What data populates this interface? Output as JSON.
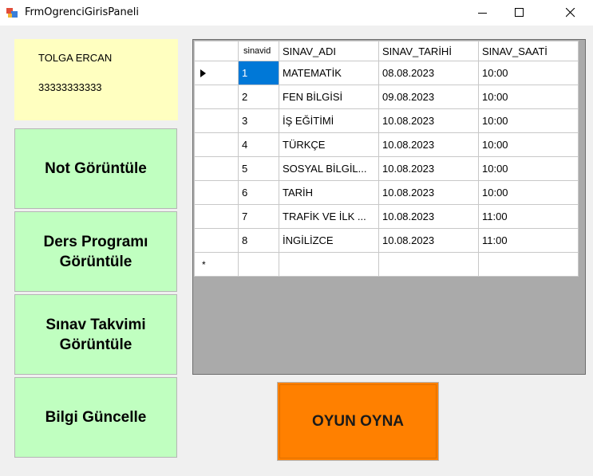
{
  "window": {
    "title": "FrmOgrenciGirisPaneli"
  },
  "student": {
    "name": "TOLGA ERCAN",
    "number": "33333333333"
  },
  "buttons": {
    "grades": "Not Görüntüle",
    "schedule_line1": "Ders Programı",
    "schedule_line2": "Görüntüle",
    "exams_line1": "Sınav Takvimi",
    "exams_line2": "Görüntüle",
    "update": "Bilgi Güncelle",
    "play": "OYUN OYNA"
  },
  "grid": {
    "columns": [
      "sinavid",
      "SINAV_ADI",
      "SINAV_TARİHİ",
      "SINAV_SAATİ"
    ],
    "rows": [
      [
        "1",
        "MATEMATİK",
        "08.08.2023",
        "10:00"
      ],
      [
        "2",
        "FEN BİLGİSİ",
        "09.08.2023",
        "10:00"
      ],
      [
        "3",
        "İŞ EĞİTİMİ",
        "10.08.2023",
        "10:00"
      ],
      [
        "4",
        "TÜRKÇE",
        "10.08.2023",
        "10:00"
      ],
      [
        "5",
        "SOSYAL BİLGİL...",
        "10.08.2023",
        "10:00"
      ],
      [
        "6",
        "TARİH",
        "10.08.2023",
        "10:00"
      ],
      [
        "7",
        "TRAFİK VE İLK ...",
        "10.08.2023",
        "11:00"
      ],
      [
        "8",
        "İNGİLİZCE",
        "10.08.2023",
        "11:00"
      ]
    ],
    "new_row_marker": "*"
  },
  "colors": {
    "info_bg": "#ffffc0",
    "button_bg": "#c0ffc0",
    "play_bg": "#ff8000",
    "selection": "#0078d7"
  },
  "icons": [
    "app-icon",
    "minimize-icon",
    "maximize-icon",
    "close-icon",
    "row-pointer-icon"
  ]
}
